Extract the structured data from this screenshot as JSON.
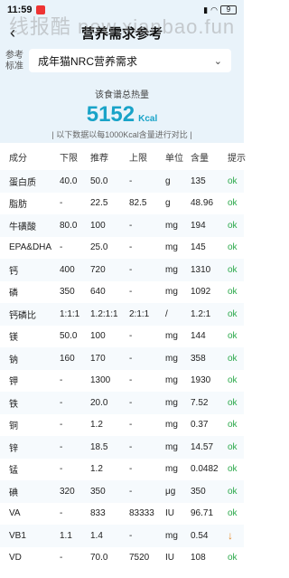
{
  "status_bar": {
    "time": "11:59",
    "battery": "9"
  },
  "watermark": "线报酷 new.xianbao.fun",
  "nav": {
    "title": "营养需求参考"
  },
  "standard": {
    "label_line1": "参考",
    "label_line2": "标准",
    "selected": "成年猫NRC营养需求"
  },
  "energy": {
    "label": "该食谱总热量",
    "value": "5152",
    "unit": "Kcal",
    "note": "| 以下数据以每1000Kcal含量进行对比 |"
  },
  "table": {
    "headers": [
      "成分",
      "下限",
      "推荐",
      "上限",
      "单位",
      "含量",
      "提示"
    ],
    "rows": [
      {
        "name": "蛋白质",
        "min": "40.0",
        "rec": "50.0",
        "max": "-",
        "unit": "g",
        "amount": "135",
        "status": "ok"
      },
      {
        "name": "脂肪",
        "min": "-",
        "rec": "22.5",
        "max": "82.5",
        "unit": "g",
        "amount": "48.96",
        "status": "ok"
      },
      {
        "name": "牛磺酸",
        "min": "80.0",
        "rec": "100",
        "max": "-",
        "unit": "mg",
        "amount": "194",
        "status": "ok"
      },
      {
        "name": "EPA&DHA",
        "min": "-",
        "rec": "25.0",
        "max": "-",
        "unit": "mg",
        "amount": "145",
        "status": "ok"
      },
      {
        "name": "钙",
        "min": "400",
        "rec": "720",
        "max": "-",
        "unit": "mg",
        "amount": "1310",
        "status": "ok"
      },
      {
        "name": "磷",
        "min": "350",
        "rec": "640",
        "max": "-",
        "unit": "mg",
        "amount": "1092",
        "status": "ok"
      },
      {
        "name": "钙磷比",
        "min": "1:1:1",
        "rec": "1.2:1:1",
        "max": "2:1:1",
        "unit": "/",
        "amount": "1.2:1",
        "status": "ok"
      },
      {
        "name": "镁",
        "min": "50.0",
        "rec": "100",
        "max": "-",
        "unit": "mg",
        "amount": "144",
        "status": "ok"
      },
      {
        "name": "钠",
        "min": "160",
        "rec": "170",
        "max": "-",
        "unit": "mg",
        "amount": "358",
        "status": "ok"
      },
      {
        "name": "钾",
        "min": "-",
        "rec": "1300",
        "max": "-",
        "unit": "mg",
        "amount": "1930",
        "status": "ok"
      },
      {
        "name": "铁",
        "min": "-",
        "rec": "20.0",
        "max": "-",
        "unit": "mg",
        "amount": "7.52",
        "status": "ok"
      },
      {
        "name": "铜",
        "min": "-",
        "rec": "1.2",
        "max": "-",
        "unit": "mg",
        "amount": "0.37",
        "status": "ok"
      },
      {
        "name": "锌",
        "min": "-",
        "rec": "18.5",
        "max": "-",
        "unit": "mg",
        "amount": "14.57",
        "status": "ok"
      },
      {
        "name": "锰",
        "min": "-",
        "rec": "1.2",
        "max": "-",
        "unit": "mg",
        "amount": "0.0482",
        "status": "ok"
      },
      {
        "name": "碘",
        "min": "320",
        "rec": "350",
        "max": "-",
        "unit": "μg",
        "amount": "350",
        "status": "ok"
      },
      {
        "name": "VA",
        "min": "-",
        "rec": "833",
        "max": "83333",
        "unit": "IU",
        "amount": "96.71",
        "status": "ok"
      },
      {
        "name": "VB1",
        "min": "1.1",
        "rec": "1.4",
        "max": "-",
        "unit": "mg",
        "amount": "0.54",
        "status": "↓"
      },
      {
        "name": "VD",
        "min": "-",
        "rec": "70.0",
        "max": "7520",
        "unit": "IU",
        "amount": "108",
        "status": "ok"
      }
    ]
  },
  "colors": {
    "accent": "#19a3c8",
    "ok": "#2aa84a",
    "low": "#e48a2a",
    "header_bg": "#e9f3fa"
  }
}
